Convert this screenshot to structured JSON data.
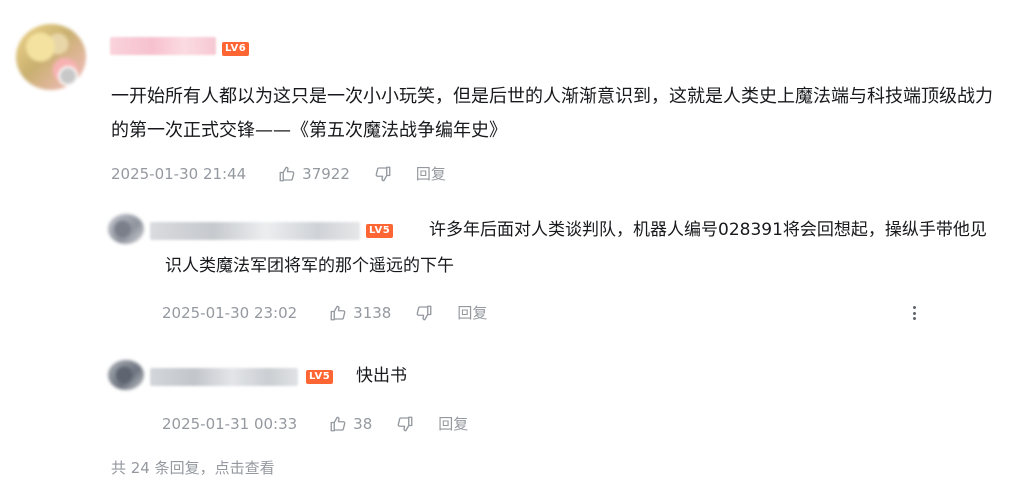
{
  "main_comment": {
    "level_badge": "LV6",
    "text": "一开始所有人都以为这只是一次小小玩笑，但是后世的人渐渐意识到，这就是人类史上魔法端与科技端顶级战力的第一次正式交锋——《第五次魔法战争编年史》",
    "time": "2025-01-30 21:44",
    "likes": "37922",
    "reply_label": "回复"
  },
  "replies": [
    {
      "level_badge": "LV5",
      "text": "许多年后面对人类谈判队，机器人编号028391将会回想起，操纵手带他见识人类魔法军团将军的那个遥远的下午",
      "time": "2025-01-30 23:02",
      "likes": "3138",
      "reply_label": "回复"
    },
    {
      "level_badge": "LV5",
      "text": "快出书",
      "time": "2025-01-31 00:33",
      "likes": "38",
      "reply_label": "回复"
    }
  ],
  "footer": {
    "total_prefix": "共 24 条回复，",
    "click_label": "点击查看"
  },
  "colors": {
    "meta_gray": "#9499a0",
    "level_badge": "#ff6633",
    "text": "#18191c"
  }
}
